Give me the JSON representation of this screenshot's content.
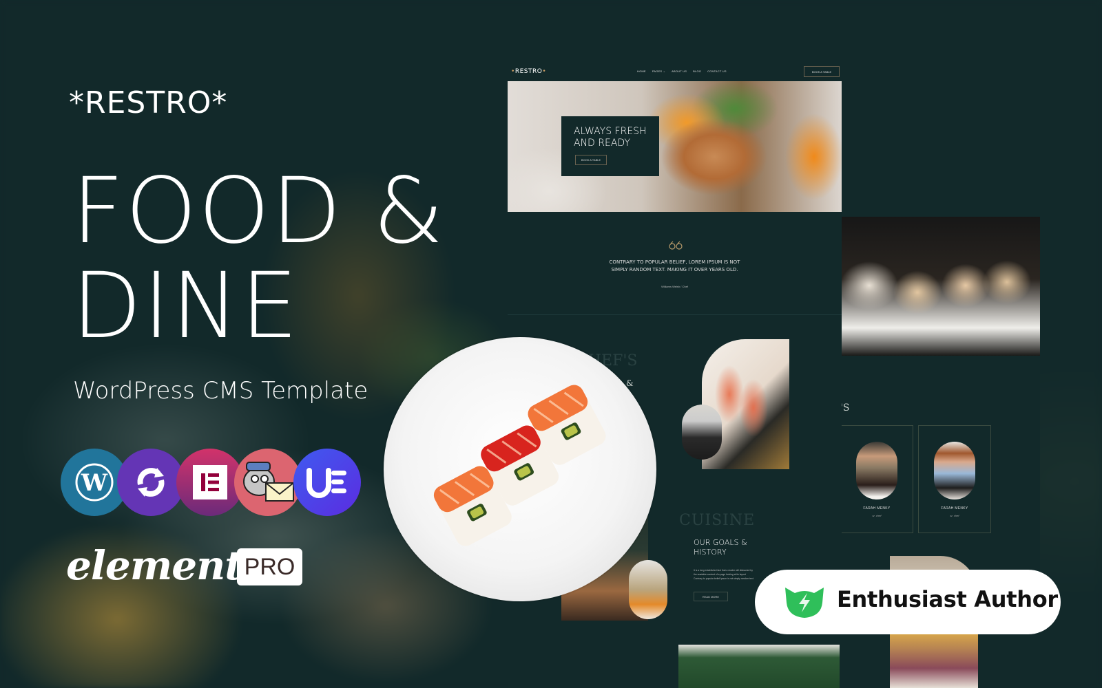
{
  "brand": {
    "name": "*RESTRO*"
  },
  "hero": {
    "headline_line1": "FOOD &",
    "headline_line2": "DINE",
    "subtitle": "WordPress CMS Template"
  },
  "plugins": [
    {
      "name": "WordPress",
      "icon": "wordpress-icon",
      "color": "#21759b"
    },
    {
      "name": "Updraft Sync",
      "icon": "sync-icon",
      "color": "#6435b5"
    },
    {
      "name": "Elementor",
      "icon": "elementor-icon",
      "color": "#d2336a"
    },
    {
      "name": "MailPoet",
      "icon": "mail-pig-icon",
      "color": "#dc6570"
    },
    {
      "name": "Ultimate Elements",
      "icon": "ue-icon",
      "color": "#4a4ef0"
    }
  ],
  "elementor": {
    "wordmark": "elementor",
    "pro_label": "PRO"
  },
  "mockup": {
    "logo": "RESTRO",
    "nav": [
      "HOME",
      "PAGES ⌄",
      "ABOUT US",
      "BLOG",
      "CONTACT US"
    ],
    "book_button": "BOOK A TABLE",
    "hero_title_line1": "ALWAYS FRESH",
    "hero_title_line2": "AND READY",
    "hero_button": "BOOK A TABLE",
    "quote_mark": "“",
    "quote_text": "CONTRARY TO POPULAR BELIEF, LOREM IPSUM IS NOT SIMPLY RANDOM TEXT. MAKING IT OVER YEARS OLD.",
    "quote_author": "Williams Welsh / Chef",
    "ghost_title_1": "CHEF'S",
    "ghost_amp": "&",
    "ghost_title_2": "CUISINE",
    "goals_title_line1": "OUR GOALS &",
    "goals_title_line2": "HISTORY",
    "goals_text": "It is a long established fact that a reader will distracted by the readable content of a page looking at its layout Contrary to popular belief Ipsum is not simply random text.",
    "goals_button": "READ MORE"
  },
  "mockup2": {
    "ghost_suffix": "'S",
    "team": [
      {
        "name": "FARAH MENKY",
        "role": "sr. chef"
      },
      {
        "name": "FARAH MENKY",
        "role": "sr. chef"
      }
    ]
  },
  "badge": {
    "label": "Enthusiast Author",
    "icon": "cat-lightning-icon",
    "color": "#2fbf5a"
  },
  "colors": {
    "background": "#12292a",
    "accent_gold": "#c89b62"
  }
}
